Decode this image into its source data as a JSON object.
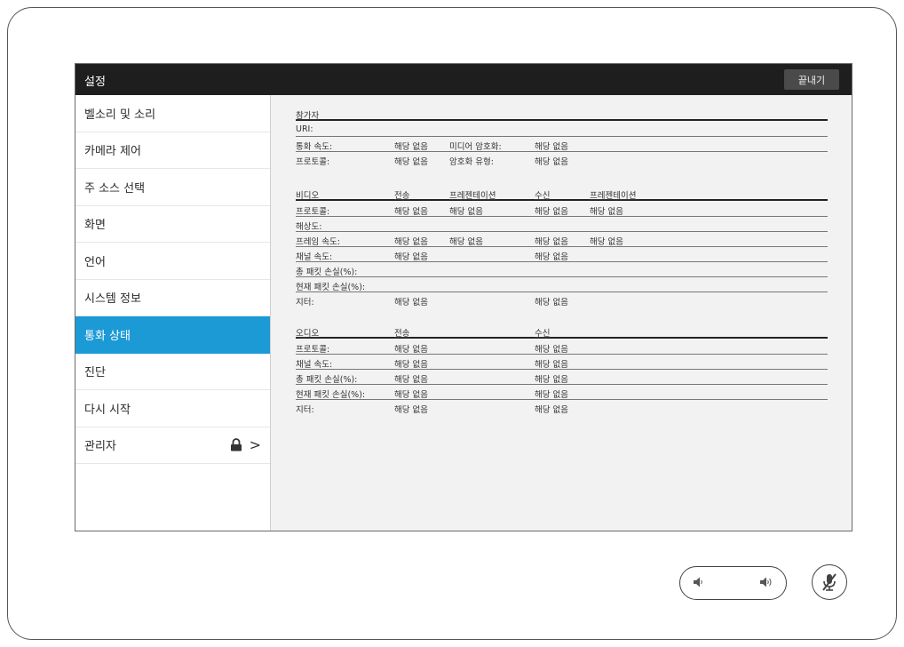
{
  "window": {
    "title": "설정",
    "end_button": "끝내기"
  },
  "sidebar": {
    "items": [
      {
        "label": "벨소리 및 소리"
      },
      {
        "label": "카메라 제어"
      },
      {
        "label": "주 소스 선택"
      },
      {
        "label": "화면"
      },
      {
        "label": "언어"
      },
      {
        "label": "시스템 정보"
      },
      {
        "label": "통화 상태",
        "active": true
      },
      {
        "label": "진단"
      },
      {
        "label": "다시 시작"
      },
      {
        "label": "관리자"
      }
    ]
  },
  "participant": {
    "header": "참가자",
    "uri_label": "URI:",
    "call_speed_label": "통화 속도:",
    "call_speed_value": "해당 없음",
    "media_encryption_label": "미디어 암호화:",
    "media_encryption_value": "해당 없음",
    "protocol_label": "프로토콜:",
    "protocol_value": "해당 없음",
    "encryption_type_label": "암호화 유형:",
    "encryption_type_value": "해당 없음"
  },
  "video": {
    "headers": [
      "비디오",
      "전송",
      "프레젠테이션",
      "수신",
      "프레젠테이션"
    ],
    "rows": [
      {
        "label": "프로토콜:",
        "values": [
          "해당 없음",
          "해당 없음",
          "해당 없음",
          "해당 없음"
        ]
      },
      {
        "label": "해상도:",
        "values": [
          "",
          "",
          "",
          ""
        ]
      },
      {
        "label": "프레임 속도:",
        "values": [
          "해당 없음",
          "해당 없음",
          "해당 없음",
          "해당 없음"
        ]
      },
      {
        "label": "채널 속도:",
        "values": [
          "해당 없음",
          "",
          "해당 없음",
          ""
        ]
      },
      {
        "label": "총 패킷 손실(%):",
        "values": [
          "",
          "",
          "",
          ""
        ]
      },
      {
        "label": "현재 패킷 손실(%):",
        "values": [
          "",
          "",
          "",
          ""
        ]
      },
      {
        "label": "지터:",
        "values": [
          "해당 없음",
          "",
          "해당 없음",
          ""
        ]
      }
    ]
  },
  "audio": {
    "headers": [
      "오디오",
      "전송",
      "수신"
    ],
    "rows": [
      {
        "label": "프로토콜:",
        "values": [
          "해당 없음",
          "해당 없음"
        ]
      },
      {
        "label": "채널 속도:",
        "values": [
          "해당 없음",
          "해당 없음"
        ]
      },
      {
        "label": "총 패킷 손실(%):",
        "values": [
          "해당 없음",
          "해당 없음"
        ]
      },
      {
        "label": "현재 패킷 손실(%):",
        "values": [
          "해당 없음",
          "해당 없음"
        ]
      },
      {
        "label": "지터:",
        "values": [
          "해당 없음",
          "해당 없음"
        ]
      }
    ]
  },
  "controls": {
    "volume_down_icon": "speaker-low-icon",
    "volume_up_icon": "speaker-high-icon",
    "mute_icon": "microphone-muted-icon",
    "lock_icon": "lock-icon",
    "chevron_icon": "chevron-right-icon"
  },
  "colors": {
    "accent": "#1b9ad6",
    "titlebar": "#1e1e1e",
    "content_bg": "#f2f2f2"
  }
}
